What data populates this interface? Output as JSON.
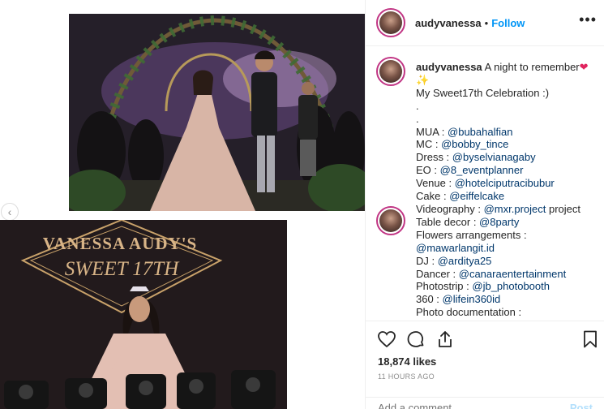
{
  "post": {
    "username": "audyvanessa",
    "follow_label": "Follow",
    "separator": "•",
    "more_glyph": "•••"
  },
  "media": {
    "top_photo_name": "party-couple-photo",
    "bottom_sign_line1": "VANESSA AUDY'S",
    "bottom_sign_line2": "SWEET 17TH",
    "prev_glyph": "‹"
  },
  "caption": {
    "username": "audyvanessa",
    "line1_text": "A night to remember",
    "heart": "❤",
    "sparkle": "✨",
    "line2": "My Sweet17th Celebration :)",
    "dot1": ".",
    "dot2": ".",
    "credits": [
      {
        "label": "MUA : ",
        "handle": "@bubahalfian",
        "suffix": ""
      },
      {
        "label": "MC : ",
        "handle": "@bobby_tince",
        "suffix": ""
      },
      {
        "label": "Dress : ",
        "handle": "@byselvianagaby",
        "suffix": ""
      },
      {
        "label": "EO : ",
        "handle": "@8_eventplanner",
        "suffix": ""
      },
      {
        "label": "Venue : ",
        "handle": "@hotelciputracibubur",
        "suffix": ""
      },
      {
        "label": "Cake : ",
        "handle": "@eiffelcake",
        "suffix": ""
      },
      {
        "label": "Videography : ",
        "handle": "@mxr.project",
        "suffix": " project"
      },
      {
        "label": "Table decor : ",
        "handle": "@8party",
        "suffix": ""
      }
    ],
    "flowers_label": "Flowers arrangements :",
    "flowers_handle": "@mawarlangit.id",
    "credits2": [
      {
        "label": "DJ : ",
        "handle": "@arditya25"
      },
      {
        "label": "Dancer : ",
        "handle": "@canaraentertainment"
      },
      {
        "label": "Photostrip : ",
        "handle": "@jb_photobooth"
      },
      {
        "label": "360 : ",
        "handle": "@lifein360id"
      }
    ],
    "last_line": "Photo documentation :"
  },
  "actions": {
    "like_icon": "heart-outline-icon",
    "comment_icon": "comment-bubble-icon",
    "share_icon": "share-icon",
    "save_icon": "bookmark-icon",
    "likes_text": "18,874 likes",
    "time_text": "11 HOURS AGO",
    "comment_placeholder": "Add a comment...",
    "post_label": "Post"
  },
  "colors": {
    "link": "#00376b",
    "follow": "#0095f6",
    "heart": "#e0245e",
    "muted": "#8e8e8e"
  }
}
